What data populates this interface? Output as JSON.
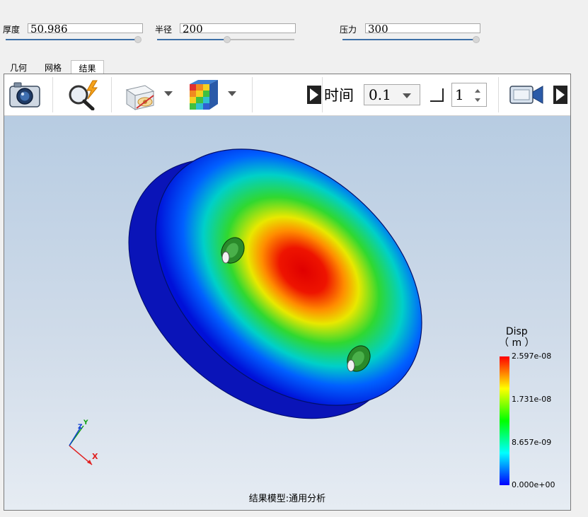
{
  "params": {
    "thickness": {
      "label": "厚度",
      "value": "50.986",
      "slider_fraction": 0.97
    },
    "radius": {
      "label": "半径",
      "value": "200",
      "slider_fraction": 0.5
    },
    "pressure": {
      "label": "压力",
      "value": "300",
      "slider_fraction": 0.97
    }
  },
  "tabs": [
    "几何",
    "网格",
    "结果"
  ],
  "active_tab": "结果",
  "toolbar": {
    "icons": [
      "camera-icon",
      "magnifier-lightning-icon",
      "display-mode-icon",
      "color-cube-icon",
      "video-camera-icon"
    ],
    "time_label": "时间",
    "time_value": "0.1",
    "step_value": "1"
  },
  "viewport": {
    "model_label": "结果模型:通用分析",
    "axes": {
      "x": "X",
      "y": "Y",
      "z": "Z"
    },
    "legend": {
      "title_line1": "Disp",
      "title_line2": "（ m ）",
      "ticks": [
        "2.597e-08",
        "1.731e-08",
        "8.657e-09",
        "0.000e+00"
      ],
      "colors": [
        "#ff0000",
        "#ffff00",
        "#00ff00",
        "#00ffff",
        "#0000ff"
      ]
    }
  }
}
